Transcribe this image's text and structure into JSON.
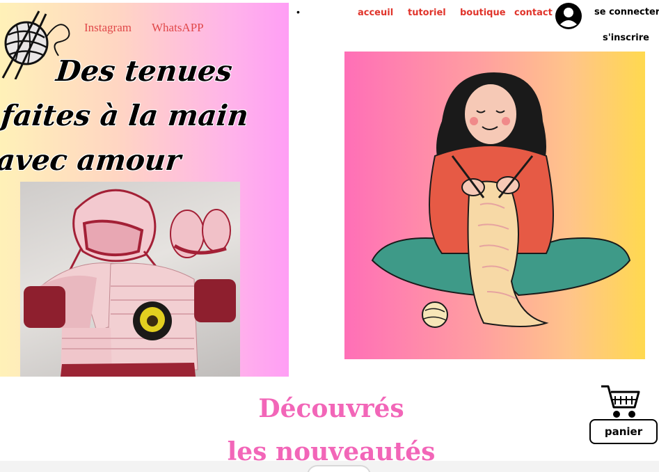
{
  "header": {
    "social": {
      "instagram": "Instagram",
      "whatsapp": "WhatsAPP"
    },
    "nav": {
      "bullet": "•",
      "accueil": "acceuil",
      "tutoriel": "tutoriel",
      "boutique": "boutique",
      "contact": "contact"
    },
    "auth": {
      "login": "se connecter",
      "register": "s'inscrire"
    }
  },
  "hero": {
    "title_lines": [
      "Des tenues",
      "faites à la main",
      "avec amour"
    ]
  },
  "discover": {
    "line1": "Découvrés",
    "line2": "les nouveautés"
  },
  "cart": {
    "label": "panier"
  },
  "colors": {
    "nav_link": "#e0342b",
    "social_link": "#e0484a",
    "discover_title": "#f266b8",
    "hero_gradient": [
      "#fff1b8",
      "#ff9ef5"
    ],
    "art_gradient": [
      "#ff6fb7",
      "#ffd94f"
    ]
  },
  "icons": {
    "logo": "yarn-ball-knitting-needles-icon",
    "avatar": "user-avatar-icon",
    "cart": "shopping-cart-icon"
  }
}
